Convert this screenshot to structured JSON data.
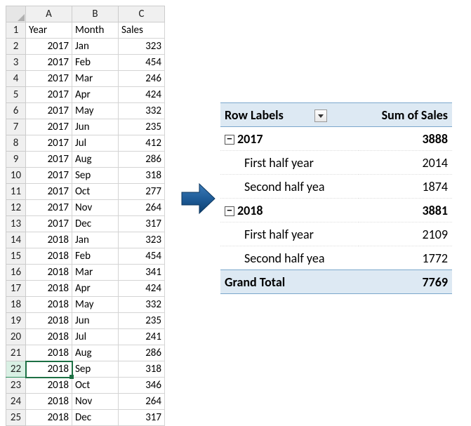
{
  "sheet": {
    "columns": [
      "A",
      "B",
      "C"
    ],
    "headers": {
      "year": "Year",
      "month": "Month",
      "sales": "Sales"
    },
    "rows": [
      {
        "n": 2,
        "year": 2017,
        "month": "Jan",
        "sales": 323
      },
      {
        "n": 3,
        "year": 2017,
        "month": "Feb",
        "sales": 454
      },
      {
        "n": 4,
        "year": 2017,
        "month": "Mar",
        "sales": 246
      },
      {
        "n": 5,
        "year": 2017,
        "month": "Apr",
        "sales": 424
      },
      {
        "n": 6,
        "year": 2017,
        "month": "May",
        "sales": 332
      },
      {
        "n": 7,
        "year": 2017,
        "month": "Jun",
        "sales": 235
      },
      {
        "n": 8,
        "year": 2017,
        "month": "Jul",
        "sales": 412
      },
      {
        "n": 9,
        "year": 2017,
        "month": "Aug",
        "sales": 286
      },
      {
        "n": 10,
        "year": 2017,
        "month": "Sep",
        "sales": 318
      },
      {
        "n": 11,
        "year": 2017,
        "month": "Oct",
        "sales": 277
      },
      {
        "n": 12,
        "year": 2017,
        "month": "Nov",
        "sales": 264
      },
      {
        "n": 13,
        "year": 2017,
        "month": "Dec",
        "sales": 317
      },
      {
        "n": 14,
        "year": 2018,
        "month": "Jan",
        "sales": 323
      },
      {
        "n": 15,
        "year": 2018,
        "month": "Feb",
        "sales": 454
      },
      {
        "n": 16,
        "year": 2018,
        "month": "Mar",
        "sales": 341
      },
      {
        "n": 17,
        "year": 2018,
        "month": "Apr",
        "sales": 424
      },
      {
        "n": 18,
        "year": 2018,
        "month": "May",
        "sales": 332
      },
      {
        "n": 19,
        "year": 2018,
        "month": "Jun",
        "sales": 235
      },
      {
        "n": 20,
        "year": 2018,
        "month": "Jul",
        "sales": 241
      },
      {
        "n": 21,
        "year": 2018,
        "month": "Aug",
        "sales": 286
      },
      {
        "n": 22,
        "year": 2018,
        "month": "Sep",
        "sales": 318
      },
      {
        "n": 23,
        "year": 2018,
        "month": "Oct",
        "sales": 346
      },
      {
        "n": 24,
        "year": 2018,
        "month": "Nov",
        "sales": 264
      },
      {
        "n": 25,
        "year": 2018,
        "month": "Dec",
        "sales": 317
      }
    ],
    "selected_row": 22
  },
  "pivot": {
    "header": {
      "row_labels": "Row Labels",
      "sum": "Sum of Sales"
    },
    "groups": [
      {
        "year": "2017",
        "total": 3888,
        "subs": [
          {
            "label": "First half year",
            "value": 2014
          },
          {
            "label": "Second half yea",
            "value": 1874
          }
        ]
      },
      {
        "year": "2018",
        "total": 3881,
        "subs": [
          {
            "label": "First half year",
            "value": 2109
          },
          {
            "label": "Second half yea",
            "value": 1772
          }
        ]
      }
    ],
    "grand": {
      "label": "Grand Total",
      "value": 7769
    }
  }
}
